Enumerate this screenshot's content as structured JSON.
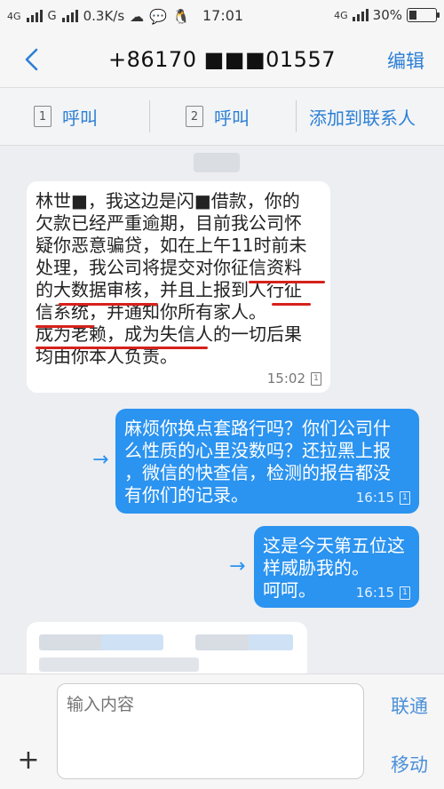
{
  "status_bar": {
    "net1": "4G",
    "net2": "G",
    "speed": "0.3K/s",
    "time": "17:01",
    "net3": "4G",
    "battery_text": "30%",
    "battery_level": 0.3
  },
  "header": {
    "title": "+86170 ■■■01557",
    "edit_label": "编辑"
  },
  "actions": {
    "call1_sim": "1",
    "call1_label": "呼叫",
    "call2_sim": "2",
    "call2_label": "呼叫",
    "add_contact_label": "添加到联系人"
  },
  "messages": [
    {
      "direction": "incoming",
      "lines": [
        "林世■，我这边是闪■借款，你的",
        "欠款已经严重逾期，目前我公司怀",
        "疑你恶意骗贷，如在上午11时前未",
        "处理，我公司将提交对你征信资料",
        "的大数据审核，并且上报到人行征",
        "信系统，并通知你所有家人。",
        "成为老赖，成为失信人的一切后果",
        "均由你本人负责。"
      ],
      "time": "15:02",
      "sim": "1"
    },
    {
      "direction": "outgoing",
      "lines": [
        "麻烦你换点套路行吗？你们公司什",
        "么性质的心里没数吗？还拉黑上报",
        "，微信的快查信，检测的报告都没",
        "有你们的记录。"
      ],
      "time": "16:15",
      "sim": "1"
    },
    {
      "direction": "outgoing",
      "lines": [
        "这是今天第五位这",
        "样威胁我的。",
        "呵呵。"
      ],
      "time": "16:15",
      "sim": "1"
    }
  ],
  "input": {
    "placeholder": "输入内容",
    "send1_label": "联通",
    "send2_label": "移动",
    "plus_symbol": "+"
  },
  "colors": {
    "accent": "#2b7fd4",
    "outgoing_bubble": "#2b93f0",
    "incoming_bubble": "#ffffff",
    "underline": "#d6221b"
  }
}
